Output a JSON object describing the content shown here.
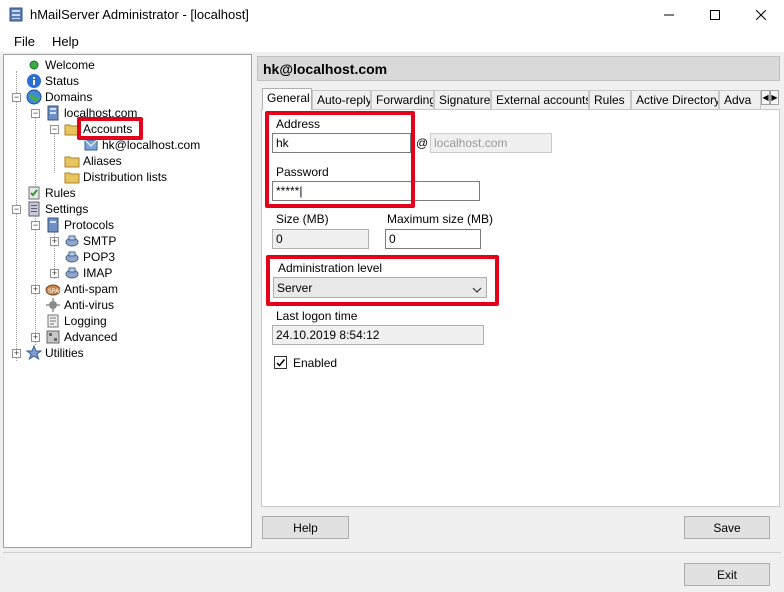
{
  "window": {
    "title": "hMailServer Administrator - [localhost]"
  },
  "menu": {
    "file": "File",
    "help": "Help"
  },
  "tree": {
    "welcome": "Welcome",
    "status": "Status",
    "domains": "Domains",
    "domain": "localhost.com",
    "accounts": "Accounts",
    "account": "hk@localhost.com",
    "aliases": "Aliases",
    "distribution_lists": "Distribution lists",
    "rules": "Rules",
    "settings": "Settings",
    "protocols": "Protocols",
    "smtp": "SMTP",
    "pop3": "POP3",
    "imap": "IMAP",
    "anti_spam": "Anti-spam",
    "anti_virus": "Anti-virus",
    "logging": "Logging",
    "advanced": "Advanced",
    "utilities": "Utilities"
  },
  "header": {
    "title": "hk@localhost.com"
  },
  "tabs": [
    {
      "label": "General"
    },
    {
      "label": "Auto-reply"
    },
    {
      "label": "Forwarding"
    },
    {
      "label": "Signature"
    },
    {
      "label": "External accounts"
    },
    {
      "label": "Rules"
    },
    {
      "label": "Active Directory"
    },
    {
      "label": "Adva"
    }
  ],
  "form": {
    "address_label": "Address",
    "address_value": "hk",
    "at_sign": "@",
    "domain_value": "localhost.com",
    "password_label": "Password",
    "password_value": "*****|",
    "size_label": "Size (MB)",
    "size_value": "0",
    "max_size_label": "Maximum size (MB)",
    "max_size_value": "0",
    "admin_level_label": "Administration level",
    "admin_level_value": "Server",
    "last_logon_label": "Last logon time",
    "last_logon_value": "24.10.2019 8:54:12",
    "enabled_label": "Enabled",
    "enabled_checked": true
  },
  "buttons": {
    "help": "Help",
    "save": "Save",
    "exit": "Exit"
  },
  "colors": {
    "highlight": "#e3001b"
  }
}
